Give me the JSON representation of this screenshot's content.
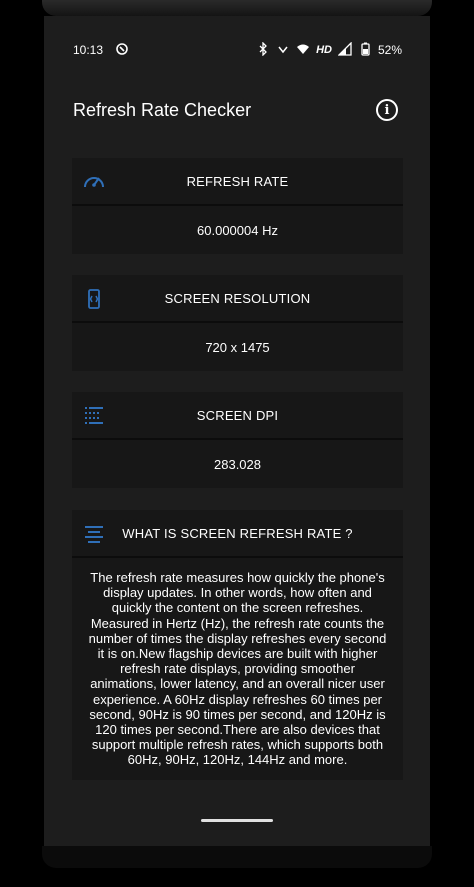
{
  "status_bar": {
    "time": "10:13",
    "network_type": "HD",
    "battery": "52%",
    "icons": [
      "sync-icon",
      "bluetooth-icon",
      "vibrate-icon",
      "wifi-icon",
      "signal-icon",
      "battery-icon"
    ]
  },
  "app_bar": {
    "title": "Refresh Rate Checker",
    "info_icon": "info-icon"
  },
  "cards": {
    "refresh": {
      "title": "REFRESH RATE",
      "value": "60.000004 Hz",
      "icon": "speedometer-icon"
    },
    "resolution": {
      "title": "SCREEN RESOLUTION",
      "value": "720 x 1475",
      "icon": "screen-resolution-icon"
    },
    "dpi": {
      "title": "SCREEN DPI",
      "value": "283.028",
      "icon": "dpi-grid-icon"
    },
    "about": {
      "title": "WHAT IS SCREEN REFRESH RATE ?",
      "icon": "text-align-icon",
      "text": "The refresh rate measures how quickly the phone's display updates. In other words, how often and quickly the content on the screen refreshes. Measured in Hertz (Hz), the refresh rate counts the number of times the display refreshes every second it is on.New flagship devices are built with higher refresh rate displays, providing smoother animations, lower latency, and an overall nicer user experience. A 60Hz display refreshes 60 times per second, 90Hz is 90 times per second, and 120Hz is 120 times per second.There are also devices that support multiple refresh rates, which supports both 60Hz, 90Hz, 120Hz, 144Hz and more."
    }
  },
  "colors": {
    "accent_icon": "#2f6fb8",
    "card_bg": "#171717",
    "screen_bg": "#1d1d1d"
  }
}
